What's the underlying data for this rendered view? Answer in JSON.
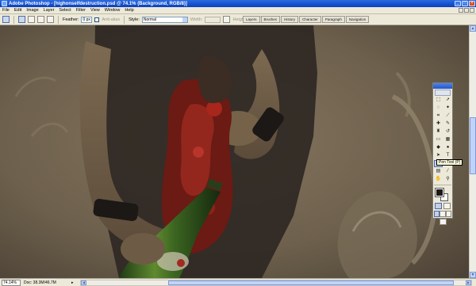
{
  "titlebar": {
    "title": "Adobe Photoshop - [highonselfdestruction.psd @ 74.1% (Background, RGB/8)]"
  },
  "menu": {
    "items": [
      "File",
      "Edit",
      "Image",
      "Layer",
      "Select",
      "Filter",
      "View",
      "Window",
      "Help"
    ]
  },
  "options": {
    "feather_label": "Feather:",
    "feather_value": "0 px",
    "antialias_label": "Anti-alias",
    "style_label": "Style:",
    "style_value": "Normal",
    "width_label": "Width:",
    "height_label": "Height:"
  },
  "palette_well": {
    "tabs": [
      "Layers",
      "Brushes",
      "History",
      "Character",
      "Paragraph",
      "Navigation"
    ]
  },
  "toolbox": {
    "tools": [
      "marquee-icon",
      "move-icon",
      "lasso-icon",
      "magic-wand-icon",
      "crop-icon",
      "slice-icon",
      "healing-brush-icon",
      "brush-icon",
      "clone-stamp-icon",
      "history-brush-icon",
      "eraser-icon",
      "gradient-icon",
      "blur-icon",
      "dodge-icon",
      "path-selection-icon",
      "type-icon",
      "pen-icon",
      "shape-icon",
      "notes-icon",
      "eyedropper-icon",
      "hand-icon",
      "zoom-icon"
    ],
    "active_tool": "pen-icon"
  },
  "tooltip": {
    "text": "Pen Tool (P)"
  },
  "status": {
    "zoom": "74.14%",
    "doc_size": "Doc: 38.3M/46.7M"
  },
  "colors": {
    "foreground": "#1c1814",
    "background": "#ffffff"
  }
}
